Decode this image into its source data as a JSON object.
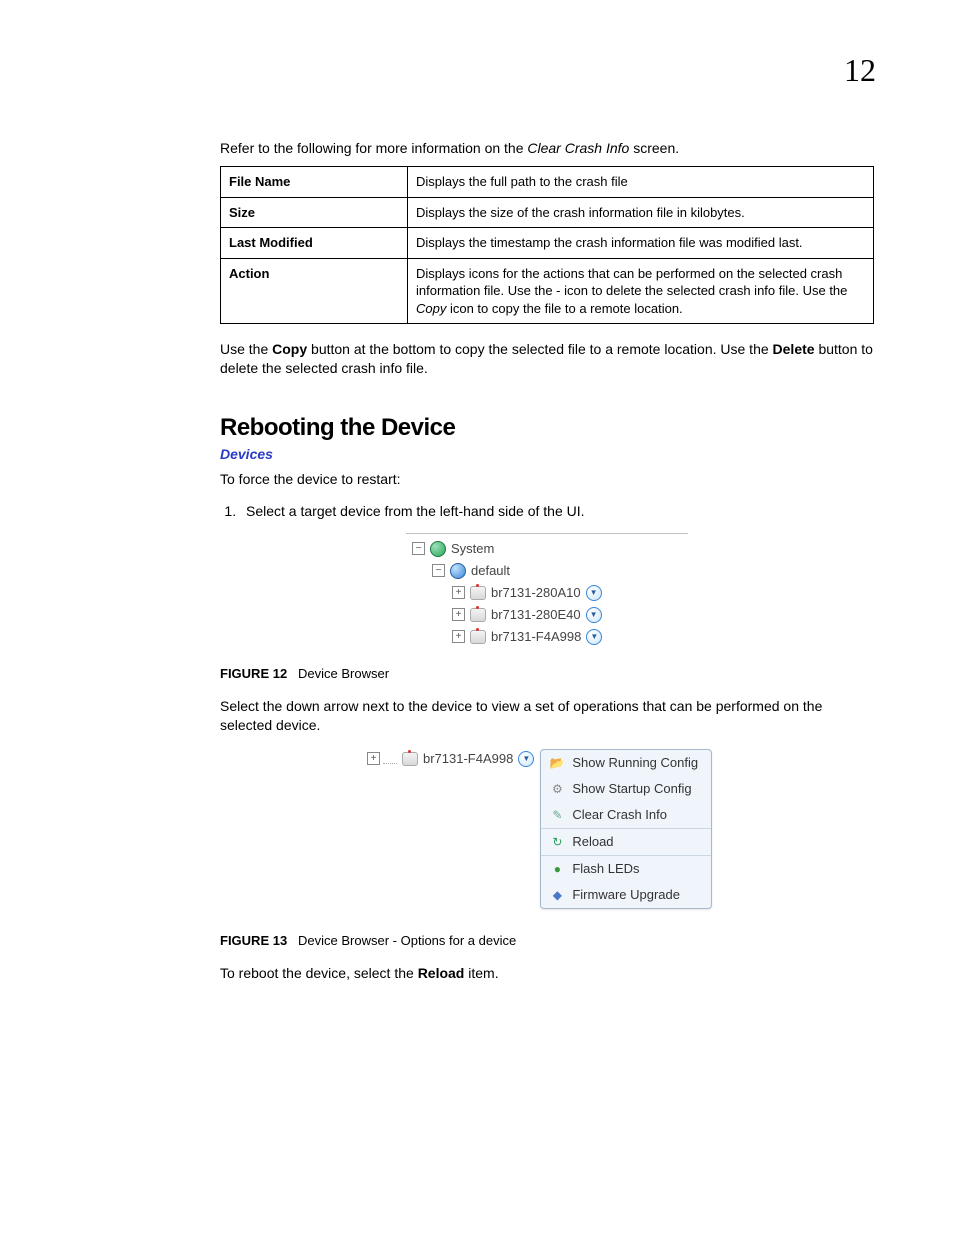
{
  "page_number": "12",
  "intro": {
    "prefix": "Refer to the following for more information on the ",
    "italic": "Clear Crash Info",
    "suffix": " screen."
  },
  "table_rows": [
    {
      "term": "File Name",
      "desc": "Displays the full path to the crash file"
    },
    {
      "term": "Size",
      "desc": "Displays the size of the crash information file in kilobytes."
    },
    {
      "term": "Last Modified",
      "desc": "Displays the timestamp the crash information file was modified last."
    },
    {
      "term": "Action",
      "desc_pre": "Displays icons for the actions that can be performed on the selected crash information file. Use the - icon to delete the selected crash info file. Use the ",
      "desc_italic": "Copy",
      "desc_post": " icon to copy the file to a remote location."
    }
  ],
  "para_after_table": {
    "p1": "Use the ",
    "b1": "Copy",
    "p2": " button at the bottom to copy the selected file to a remote location. Use the ",
    "b2": "Delete",
    "p3": " button to delete the selected crash info file."
  },
  "heading": "Rebooting the Device",
  "breadcrumb": "Devices",
  "restart_intro": "To force the device to restart:",
  "step1": "Select a target device from the left-hand side of the UI.",
  "tree": {
    "system": "System",
    "default": "default",
    "devices": [
      "br7131-280A10",
      "br7131-280E40",
      "br7131-F4A998"
    ]
  },
  "figure12": {
    "label": "FIGURE 12",
    "caption": "Device Browser"
  },
  "para_after_fig12": "Select the down arrow next to the device to view a set of operations that can be performed on the selected device.",
  "fig13_device": "br7131-F4A998",
  "context_menu_items": [
    "Show Running Config",
    "Show Startup Config",
    "Clear Crash Info",
    "Reload",
    "Flash LEDs",
    "Firmware Upgrade"
  ],
  "figure13": {
    "label": "FIGURE 13",
    "caption": "Device Browser - Options for a device"
  },
  "reboot_para": {
    "p1": "To reboot the device, select the ",
    "b1": "Reload",
    "p2": " item."
  }
}
